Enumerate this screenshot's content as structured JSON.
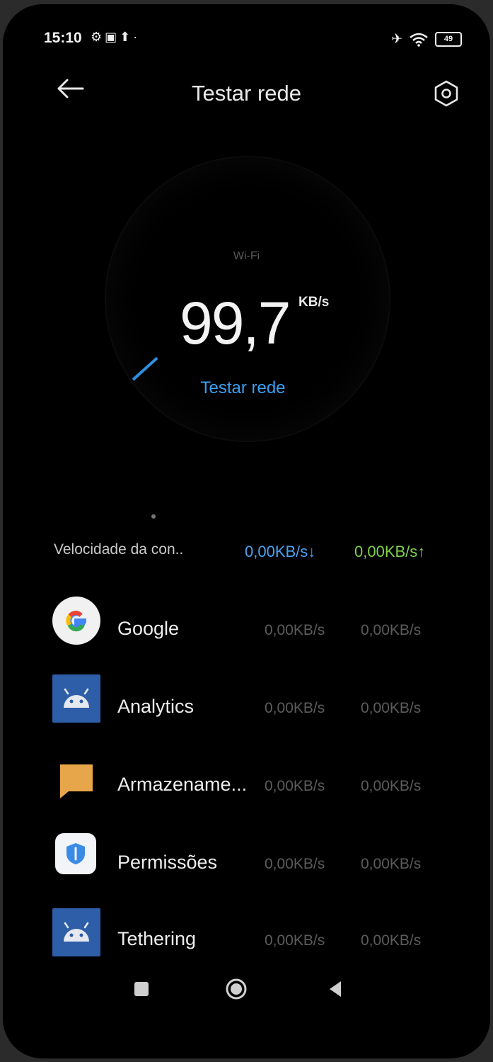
{
  "status_bar": {
    "time": "15:10",
    "battery": "49"
  },
  "header": {
    "title": "Testar rede"
  },
  "gauge": {
    "network_type": "Wi-Fi",
    "speed": "99,7",
    "unit": "KB/s",
    "test_label": "Testar rede"
  },
  "summary": {
    "label": "Velocidade da con..",
    "download": "0,00KB/s↓",
    "upload": "0,00KB/s↑"
  },
  "apps": [
    {
      "name": "Google",
      "icon": "google-icon",
      "download": "0,00KB/s",
      "upload": "0,00KB/s"
    },
    {
      "name": "Analytics",
      "icon": "android-icon",
      "download": "0,00KB/s",
      "upload": "0,00KB/s"
    },
    {
      "name": "Armazename...",
      "icon": "storage-icon",
      "download": "0,00KB/s",
      "upload": "0,00KB/s"
    },
    {
      "name": "Permissões",
      "icon": "permissions-icon",
      "download": "0,00KB/s",
      "upload": "0,00KB/s"
    },
    {
      "name": "Tethering",
      "icon": "android-icon",
      "download": "0,00KB/s",
      "upload": "0,00KB/s"
    }
  ],
  "navbar": {
    "recents": "recents-icon",
    "home": "home-icon",
    "back": "back-icon"
  },
  "colors": {
    "accent_blue": "#3c9ef0",
    "upload_green": "#7fd14a",
    "background": "#000000"
  }
}
